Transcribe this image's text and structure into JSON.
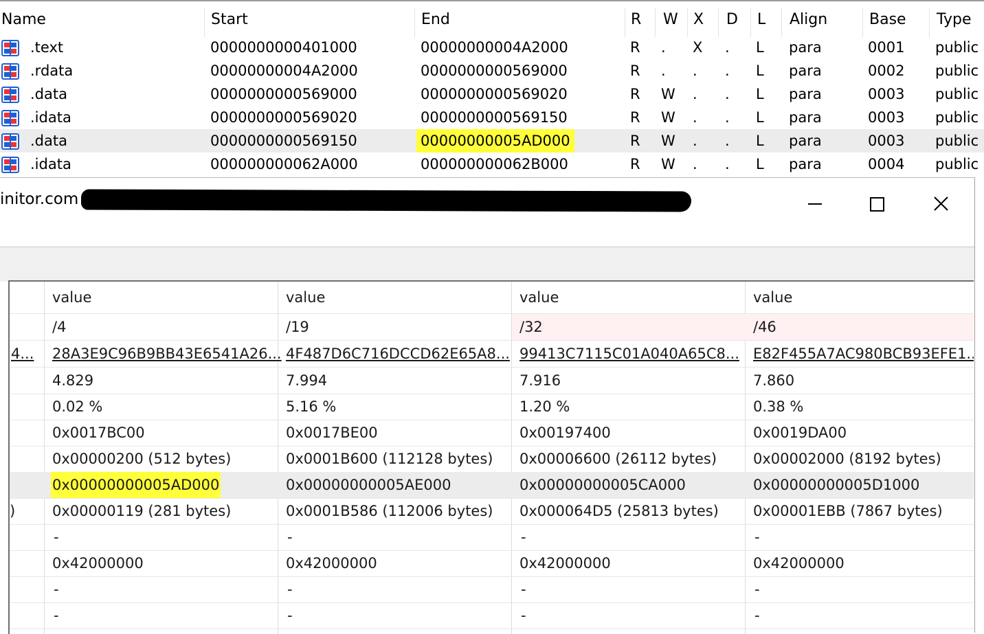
{
  "segments": {
    "headers": [
      "Name",
      "Start",
      "End",
      "R",
      "W",
      "X",
      "D",
      "L",
      "Align",
      "Base",
      "Type"
    ],
    "rows": [
      {
        "name": ".text",
        "start": "0000000000401000",
        "end": "00000000004A2000",
        "r": "R",
        "w": ".",
        "x": "X",
        "d": ".",
        "l": "L",
        "align": "para",
        "base": "0001",
        "type": "public"
      },
      {
        "name": ".rdata",
        "start": "00000000004A2000",
        "end": "0000000000569000",
        "r": "R",
        "w": ".",
        "x": ".",
        "d": ".",
        "l": "L",
        "align": "para",
        "base": "0002",
        "type": "public"
      },
      {
        "name": ".data",
        "start": "0000000000569000",
        "end": "0000000000569020",
        "r": "R",
        "w": "W",
        "x": ".",
        "d": ".",
        "l": "L",
        "align": "para",
        "base": "0003",
        "type": "public"
      },
      {
        "name": ".idata",
        "start": "0000000000569020",
        "end": "0000000000569150",
        "r": "R",
        "w": "W",
        "x": ".",
        "d": ".",
        "l": "L",
        "align": "para",
        "base": "0003",
        "type": "public"
      },
      {
        "name": ".data",
        "start": "0000000000569150",
        "end": "00000000005AD000",
        "r": "R",
        "w": "W",
        "x": ".",
        "d": ".",
        "l": "L",
        "align": "para",
        "base": "0003",
        "type": "public"
      },
      {
        "name": ".idata",
        "start": "000000000062A000",
        "end": "000000000062B000",
        "r": "R",
        "w": "W",
        "x": ".",
        "d": ".",
        "l": "L",
        "align": "para",
        "base": "0004",
        "type": "public"
      }
    ]
  },
  "window": {
    "title_visible": "initor.com [",
    "minimize_glyph": "—",
    "maximize_glyph": "☐",
    "close_glyph": "✕"
  },
  "grid": {
    "left_edge": [
      "4...",
      ")"
    ],
    "columns": [
      {
        "header": "value",
        "cells": [
          "/4",
          "28A3E9C96B9BB43E6541A26...",
          "4.829",
          "0.02 %",
          "0x0017BC00",
          "0x00000200 (512 bytes)",
          "0x00000000005AD000",
          "0x00000119 (281 bytes)",
          "-",
          "0x42000000",
          "-",
          "-"
        ]
      },
      {
        "header": "value",
        "cells": [
          "/19",
          "4F487D6C716DCCD62E65A8...",
          "7.994",
          "5.16 %",
          "0x0017BE00",
          "0x0001B600 (112128 bytes)",
          "0x00000000005AE000",
          "0x0001B586 (112006 bytes)",
          "-",
          "0x42000000",
          "-",
          "-"
        ]
      },
      {
        "header": "value",
        "cells": [
          "/32",
          "99413C7115C01A040A65C8...",
          "7.916",
          "1.20 %",
          "0x00197400",
          "0x00006600 (26112 bytes)",
          "0x00000000005CA000",
          "0x000064D5 (25813 bytes)",
          "-",
          "0x42000000",
          "-",
          "-"
        ]
      },
      {
        "header": "value",
        "cells": [
          "/46",
          "E82F455A7AC980BCB93EFE1...",
          "7.860",
          "0.38 %",
          "0x0019DA00",
          "0x00002000 (8192 bytes)",
          "0x00000000005D1000",
          "0x00001EBB (7867 bytes)",
          "-",
          "0x42000000",
          "-",
          "-"
        ]
      }
    ]
  },
  "colors": {
    "highlight": "#ffff3a",
    "link": "#1a1ae6",
    "red_value": "#d0202a",
    "selected_row": "#ececec"
  }
}
